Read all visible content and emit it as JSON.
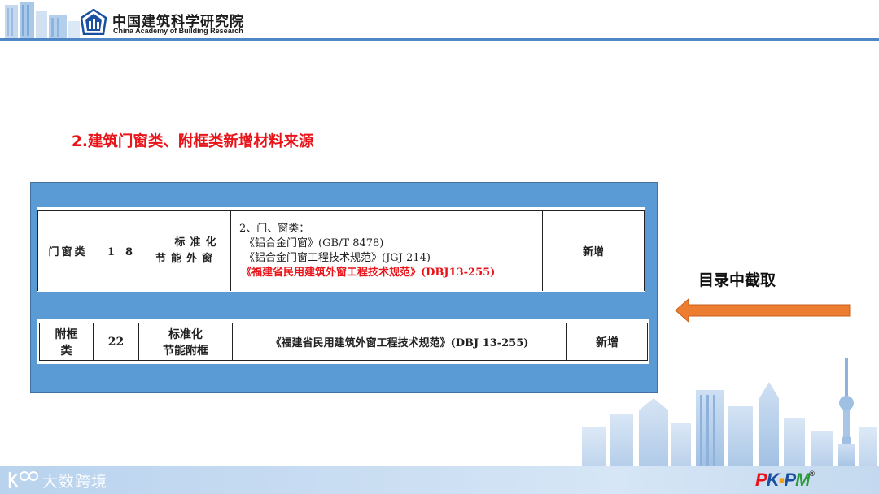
{
  "header": {
    "org_name_cn": "中国建筑科学研究院",
    "org_name_en": "China Academy of Building Research"
  },
  "section_title": "2.建筑门窗类、附框类新增材料来源",
  "table1": {
    "category": "门窗类",
    "number": "1　8",
    "product_type_line1": "标准化",
    "product_type_line2": "节能外窗",
    "standards": [
      "2、门、窗类：",
      "《铝合金门窗》(GB/T 8478)",
      "《铝合金门窗工程技术规范》(JGJ 214)",
      "《福建省民用建筑外窗工程技术规范》(DBJ13-255)"
    ],
    "status": "新增"
  },
  "table2": {
    "category_line1": "附框",
    "category_line2": "类",
    "number": "22",
    "product_type_line1": "标准化",
    "product_type_line2": "节能附框",
    "standard": "《福建省民用建筑外窗工程技术规范》(DBJ 13-255)",
    "status": "新增"
  },
  "callout": {
    "text": "目录中截取"
  },
  "colors": {
    "title_red": "#e8141a",
    "panel_blue": "#5b9bd5",
    "arrow_orange": "#ed7d31",
    "header_line_blue": "#4f86c6"
  },
  "footer": {
    "watermark": "大数跨境",
    "brand": "PKPM"
  },
  "icons": {
    "header_logo": "building-emblem-icon",
    "arrow": "left-arrow-icon",
    "watermark_logo": "watermark-logo-icon"
  }
}
